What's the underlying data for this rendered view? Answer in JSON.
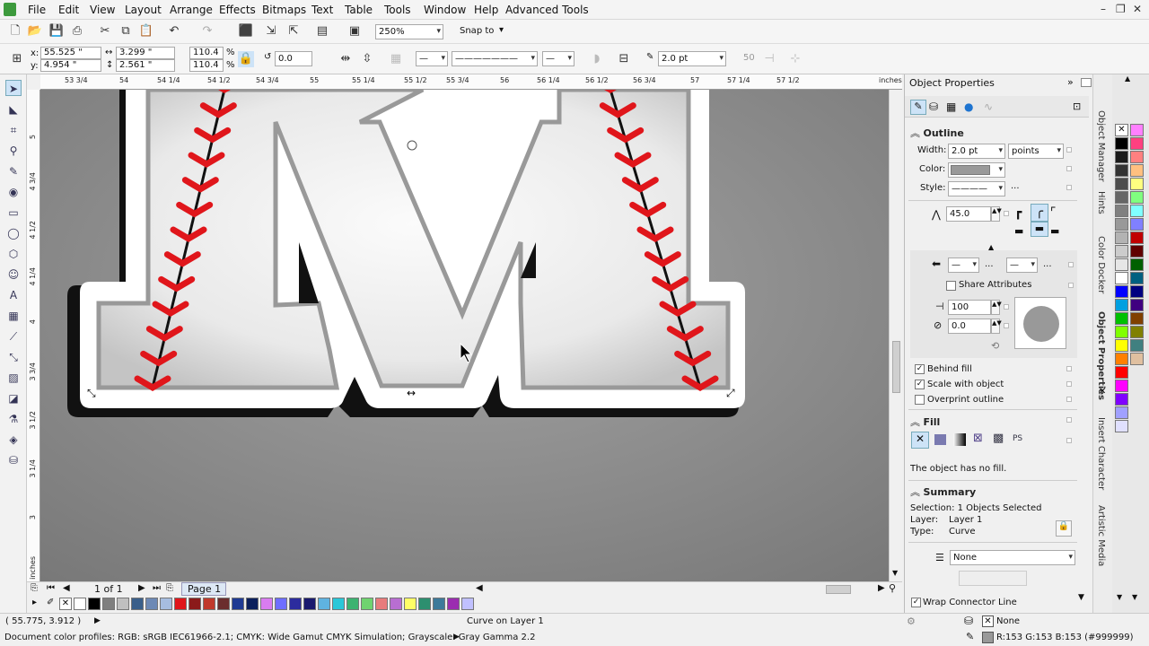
{
  "menu": {
    "items": [
      "File",
      "Edit",
      "View",
      "Layout",
      "Arrange",
      "Effects",
      "Bitmaps",
      "Text",
      "Table",
      "Tools",
      "Window",
      "Help",
      "Advanced Tools"
    ]
  },
  "toolbar": {
    "zoom": "250%",
    "snap_to": "Snap to"
  },
  "propbar": {
    "x": "55.525 \"",
    "y": "4.954 \"",
    "w": "3.299 \"",
    "h": "2.561 \"",
    "scale_x": "110.4",
    "scale_y": "110.4",
    "percent": "%",
    "rotation": "0.0",
    "outline_width": "2.0 pt",
    "value_50": "50"
  },
  "ruler": {
    "top_labels": [
      "53 3/4",
      "54",
      "54 1/4",
      "54 1/2",
      "54 3/4",
      "55",
      "55 1/4",
      "55 1/2",
      "55 3/4",
      "56",
      "56 1/4",
      "56 1/2",
      "56 3/4",
      "57",
      "57 1/4",
      "57 1/2"
    ],
    "unit": "inches",
    "left_labels": [
      "5",
      "4 3/4",
      "4 1/2",
      "4 1/4",
      "4",
      "3 3/4",
      "3 1/2",
      "3 1/4",
      "3"
    ]
  },
  "pages": {
    "counter": "1 of 1",
    "tab": "Page 1"
  },
  "status": {
    "coords": "( 55.775, 3.912 )",
    "object_info": "Curve on Layer 1",
    "color_profiles": "Document color profiles: RGB: sRGB IEC61966-2.1; CMYK: Wide Gamut CMYK Simulation; Grayscale: Gray Gamma 2.2",
    "fill_status": "None",
    "outline_status": "R:153 G:153 B:153 (#999999)"
  },
  "docker": {
    "title": "Object Properties",
    "outline": {
      "header": "Outline",
      "width_label": "Width:",
      "width_value": "2.0 pt",
      "units": "points",
      "color_label": "Color:",
      "style_label": "Style:",
      "miter": "45.0",
      "share_attributes": "Share Attributes",
      "stretch": "100",
      "angle": "0.0",
      "behind_fill": "Behind fill",
      "scale_with_object": "Scale with object",
      "overprint_outline": "Overprint outline"
    },
    "fill": {
      "header": "Fill",
      "no_fill_text": "The object has no fill."
    },
    "summary": {
      "header": "Summary",
      "selection": "Selection: 1 Objects Selected",
      "layer_label": "Layer:",
      "layer_value": "Layer 1",
      "type_label": "Type:",
      "type_value": "Curve"
    },
    "wrap_mode": "None",
    "wrap_connector": "Wrap Connector Line"
  },
  "side_tabs": [
    "Object Manager",
    "Hints",
    "Color Docker",
    "Object Properties",
    "Insert Character",
    "Artistic Media"
  ],
  "colors": {
    "outline_gray": "#999999",
    "stitch_red": "#e0161b",
    "canvas_bg": "#8f8f8f",
    "letter_fill": "#f2f2f2"
  },
  "doc_palette": [
    "#ffffff",
    "#000000",
    "#7f7f7f",
    "#c0c0c0",
    "#3a5f8a",
    "#6d89b5",
    "#a6bde0",
    "#e0161b",
    "#8b1a1a",
    "#c0392b",
    "#6b2d2d",
    "#1f3a93",
    "#0b1f5c",
    "#d97cf0",
    "#6e6eff",
    "#2c2c9e",
    "#1a1a6e",
    "#5fb3e0",
    "#2bc7d8",
    "#3cb371",
    "#6fd36f",
    "#e87c7c",
    "#b86ed1",
    "#ffff66",
    "#2d8f6f",
    "#3d7a9a",
    "#9b2db0",
    "#c0c0ff"
  ],
  "palette": [
    "#000000",
    "#1a1a1a",
    "#333333",
    "#4d4d4d",
    "#666666",
    "#808080",
    "#999999",
    "#b3b3b3",
    "#cccccc",
    "#e6e6e6",
    "#ffffff",
    "#0000ff",
    "#00a0e0",
    "#00c000",
    "#80ff00",
    "#ffff00",
    "#ff8000",
    "#ff0000",
    "#ff00ff",
    "#8000ff",
    "#a0a0ff",
    "#e0e0ff",
    "#ff80ff",
    "#ff4080",
    "#ff8080",
    "#ffc080",
    "#ffff80",
    "#80ff80",
    "#80ffff",
    "#8080ff",
    "#c00000",
    "#600000",
    "#006000",
    "#006080",
    "#000080",
    "#400080",
    "#804000",
    "#808000",
    "#408080",
    "#e0c0a0"
  ]
}
